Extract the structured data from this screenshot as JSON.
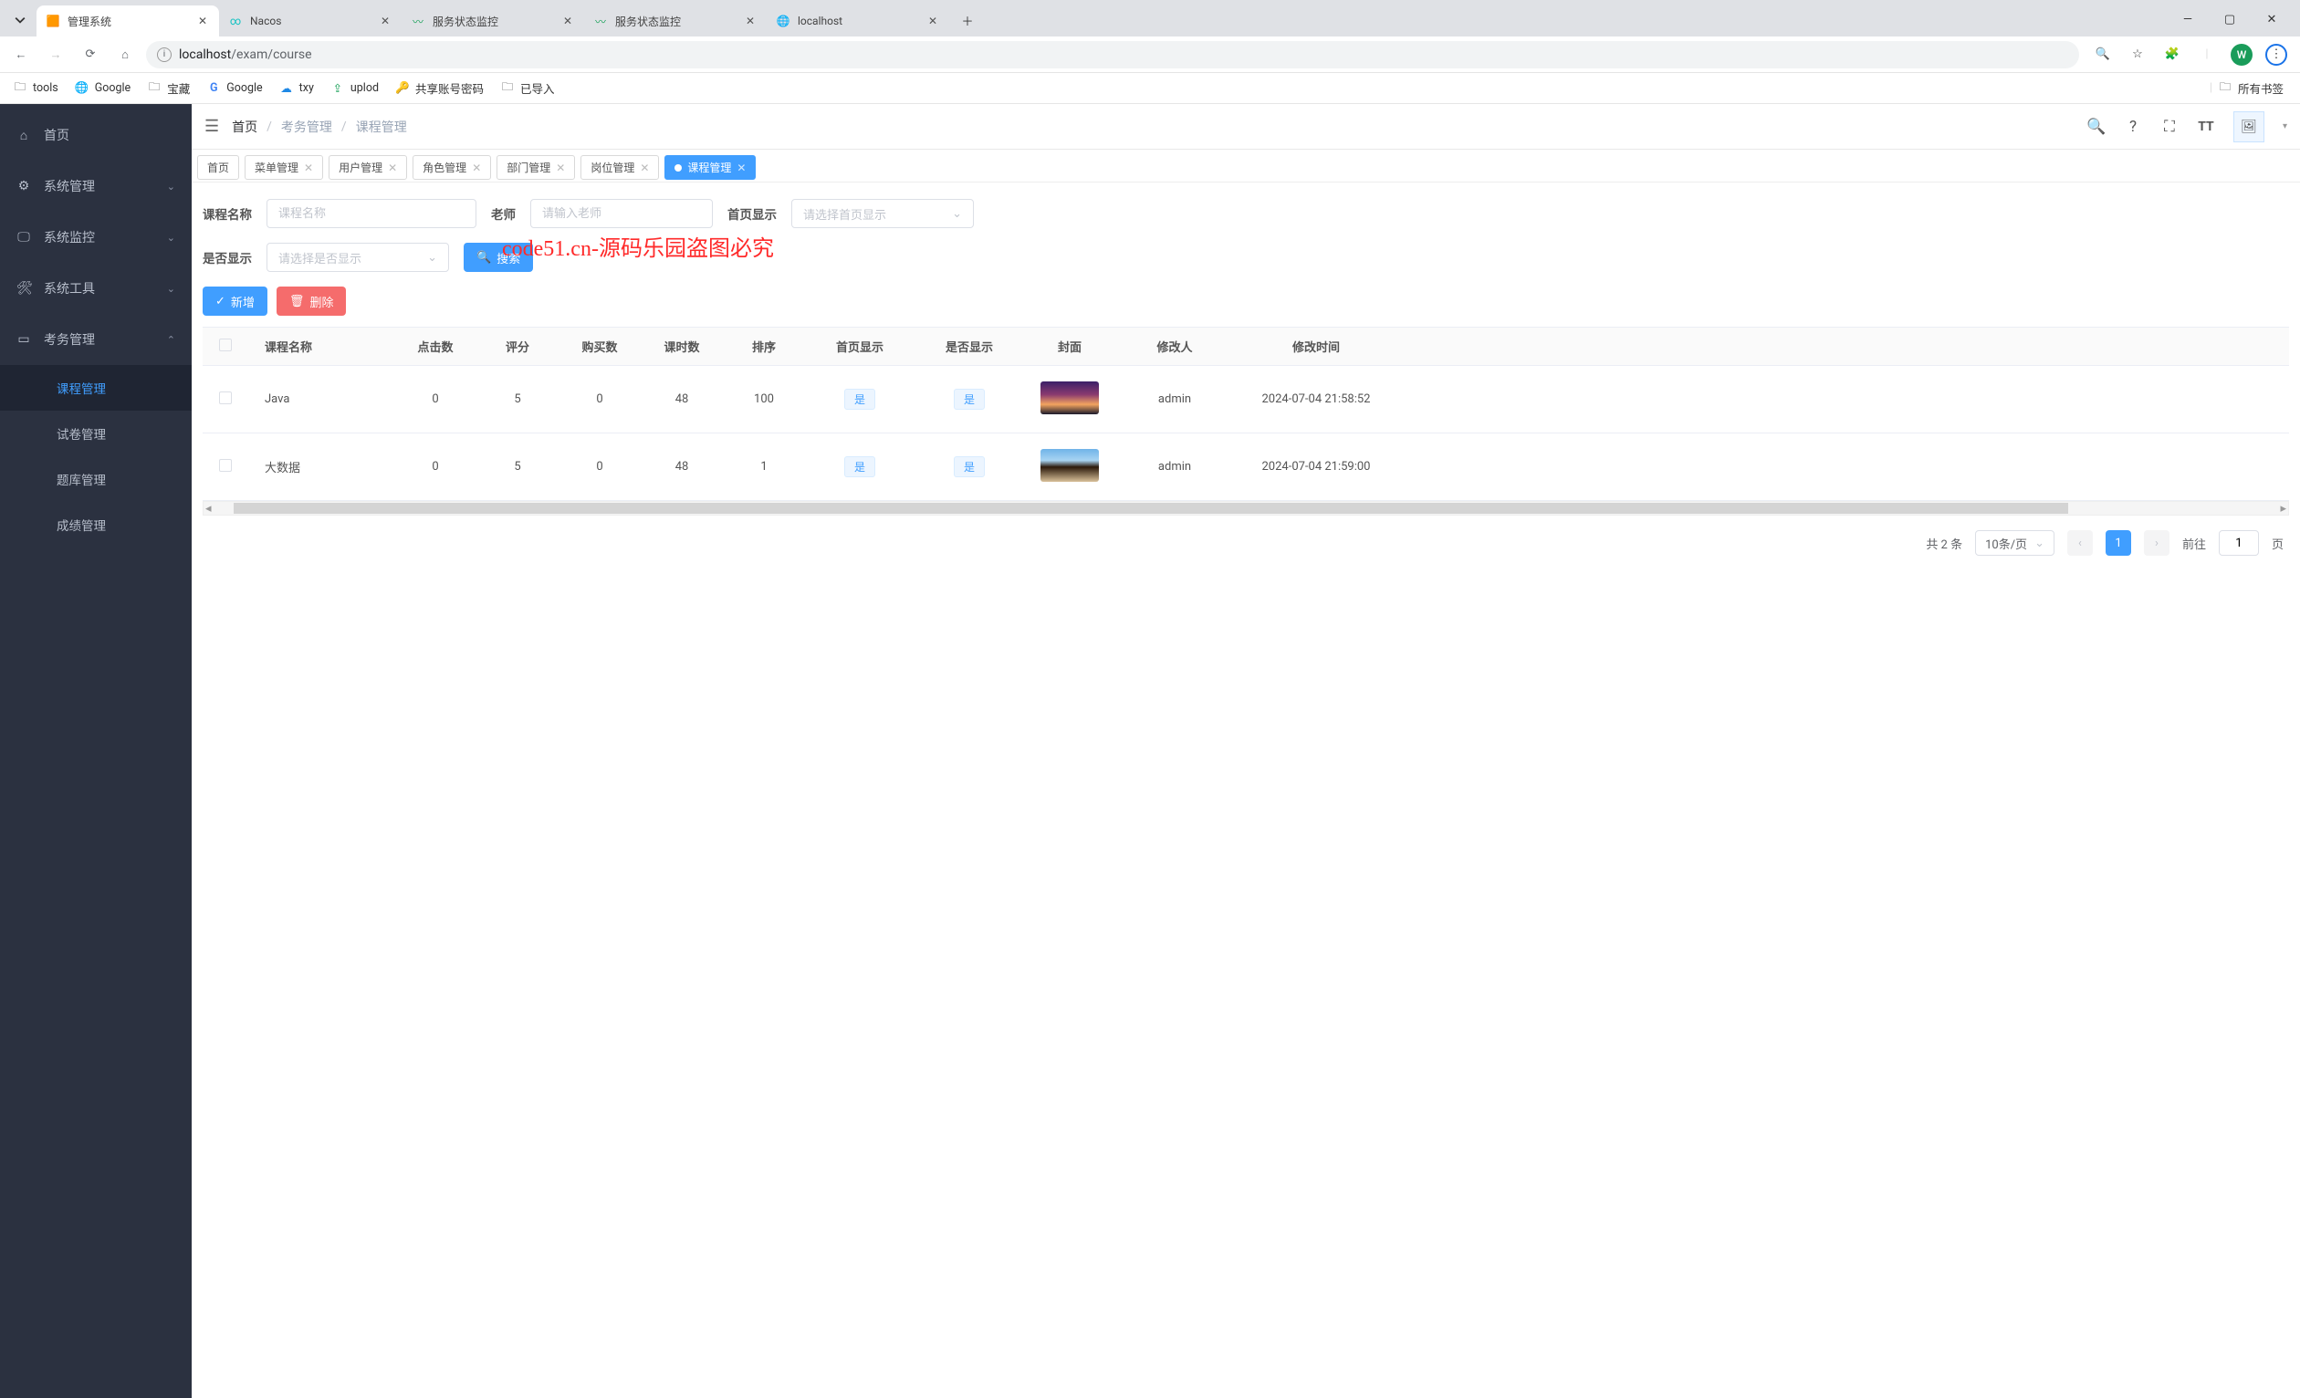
{
  "browser": {
    "tabs": [
      {
        "title": "管理系统",
        "active": true
      },
      {
        "title": "Nacos",
        "active": false
      },
      {
        "title": "服务状态监控",
        "active": false
      },
      {
        "title": "服务状态监控",
        "active": false
      },
      {
        "title": "localhost",
        "active": false
      }
    ],
    "url_host": "localhost",
    "url_path": "/exam/course",
    "avatar_letter": "W",
    "bookmarks": [
      {
        "icon": "folder",
        "label": "tools"
      },
      {
        "icon": "globe",
        "label": "Google"
      },
      {
        "icon": "folder",
        "label": "宝藏"
      },
      {
        "icon": "g",
        "label": "Google"
      },
      {
        "icon": "cloud",
        "label": "txy"
      },
      {
        "icon": "up",
        "label": "uplod"
      },
      {
        "icon": "acct",
        "label": "共享账号密码"
      },
      {
        "icon": "folder",
        "label": "已导入"
      }
    ],
    "all_bookmarks": "所有书签"
  },
  "sidebar": {
    "items": [
      {
        "icon": "dash",
        "label": "首页",
        "chev": false
      },
      {
        "icon": "gear",
        "label": "系统管理",
        "chev": true
      },
      {
        "icon": "monitor",
        "label": "系统监控",
        "chev": true
      },
      {
        "icon": "tool",
        "label": "系统工具",
        "chev": true
      },
      {
        "icon": "book",
        "label": "考务管理",
        "chev": true,
        "open": true
      }
    ],
    "subs": [
      {
        "label": "课程管理",
        "active": true
      },
      {
        "label": "试卷管理",
        "active": false
      },
      {
        "label": "题库管理",
        "active": false
      },
      {
        "label": "成绩管理",
        "active": false
      }
    ]
  },
  "breadcrumb": {
    "home": "首页",
    "mid": "考务管理",
    "cur": "课程管理"
  },
  "tabs_row": [
    {
      "label": "首页",
      "closable": false
    },
    {
      "label": "菜单管理",
      "closable": true
    },
    {
      "label": "用户管理",
      "closable": true
    },
    {
      "label": "角色管理",
      "closable": true
    },
    {
      "label": "部门管理",
      "closable": true
    },
    {
      "label": "岗位管理",
      "closable": true
    },
    {
      "label": "课程管理",
      "closable": true,
      "active": true
    }
  ],
  "filters": {
    "course_label": "课程名称",
    "course_ph": "课程名称",
    "teacher_label": "老师",
    "teacher_ph": "请输入老师",
    "home_label": "首页显示",
    "home_ph": "请选择首页显示",
    "show_label": "是否显示",
    "show_ph": "请选择是否显示",
    "search_btn": "搜索"
  },
  "actions": {
    "add": "新增",
    "del": "删除"
  },
  "table": {
    "headers": [
      "",
      "课程名称",
      "点击数",
      "评分",
      "购买数",
      "课时数",
      "排序",
      "首页显示",
      "是否显示",
      "封面",
      "修改人",
      "修改时间"
    ],
    "rows": [
      {
        "name": "Java",
        "clicks": "0",
        "score": "5",
        "buys": "0",
        "lessons": "48",
        "sort": "100",
        "home": "是",
        "show": "是",
        "cover": "thumb1",
        "editor": "admin",
        "time": "2024-07-04 21:58:52"
      },
      {
        "name": "大数据",
        "clicks": "0",
        "score": "5",
        "buys": "0",
        "lessons": "48",
        "sort": "1",
        "home": "是",
        "show": "是",
        "cover": "thumb2",
        "editor": "admin",
        "time": "2024-07-04 21:59:00"
      }
    ]
  },
  "pager": {
    "total": "共 2 条",
    "perpage": "10条/页",
    "cur": "1",
    "goto": "前往",
    "page_val": "1",
    "suffix": "页"
  },
  "watermark": "code51.cn-源码乐园盗图必究"
}
